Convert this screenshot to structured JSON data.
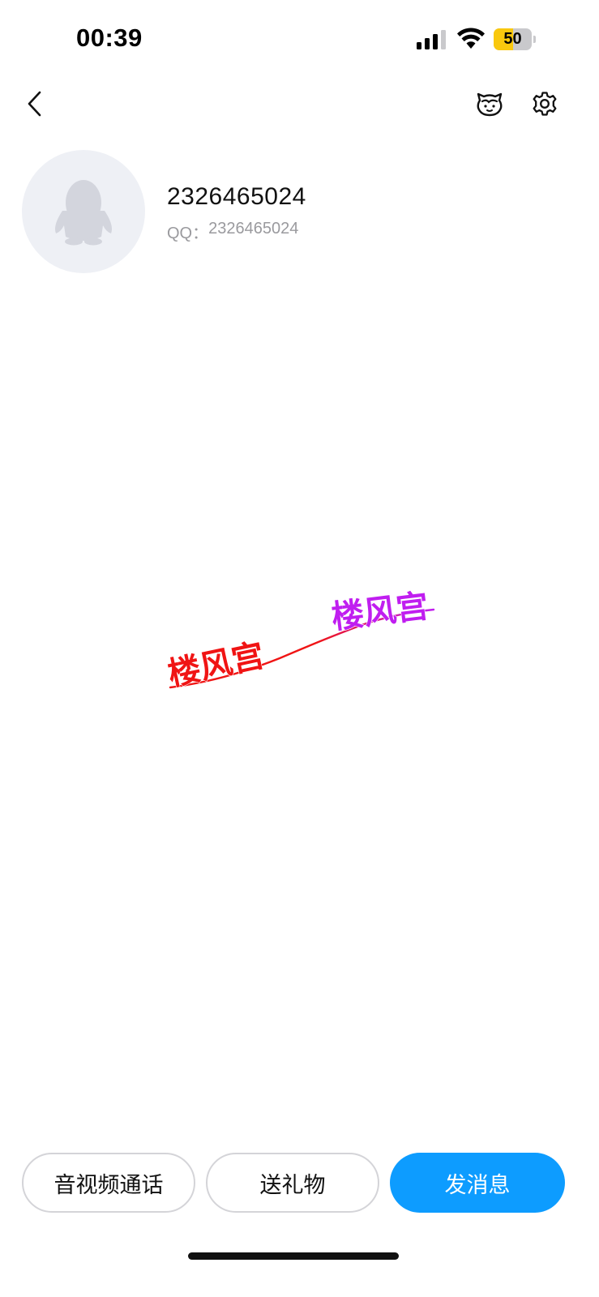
{
  "status_bar": {
    "time": "00:39",
    "battery_level": "50",
    "battery_percent": 50,
    "icons": [
      "signal-icon",
      "wifi-icon",
      "battery-icon"
    ]
  },
  "nav": {
    "icons": [
      "chevron-left-icon",
      "avatar-pendant-icon",
      "gear-icon"
    ]
  },
  "profile": {
    "nickname": "2326465024",
    "qq_label": "QQ：",
    "qq_number": "2326465024",
    "avatar_icon": "penguin-placeholder-icon"
  },
  "signature": {
    "left_text": "楼风宫",
    "right_text": "楼风宫",
    "left_color": "#f01414",
    "right_color": "#c01ef0"
  },
  "actions": {
    "call_label": "音视频通话",
    "gift_label": "送礼物",
    "message_label": "发消息",
    "accent_color": "#0d9cff"
  }
}
